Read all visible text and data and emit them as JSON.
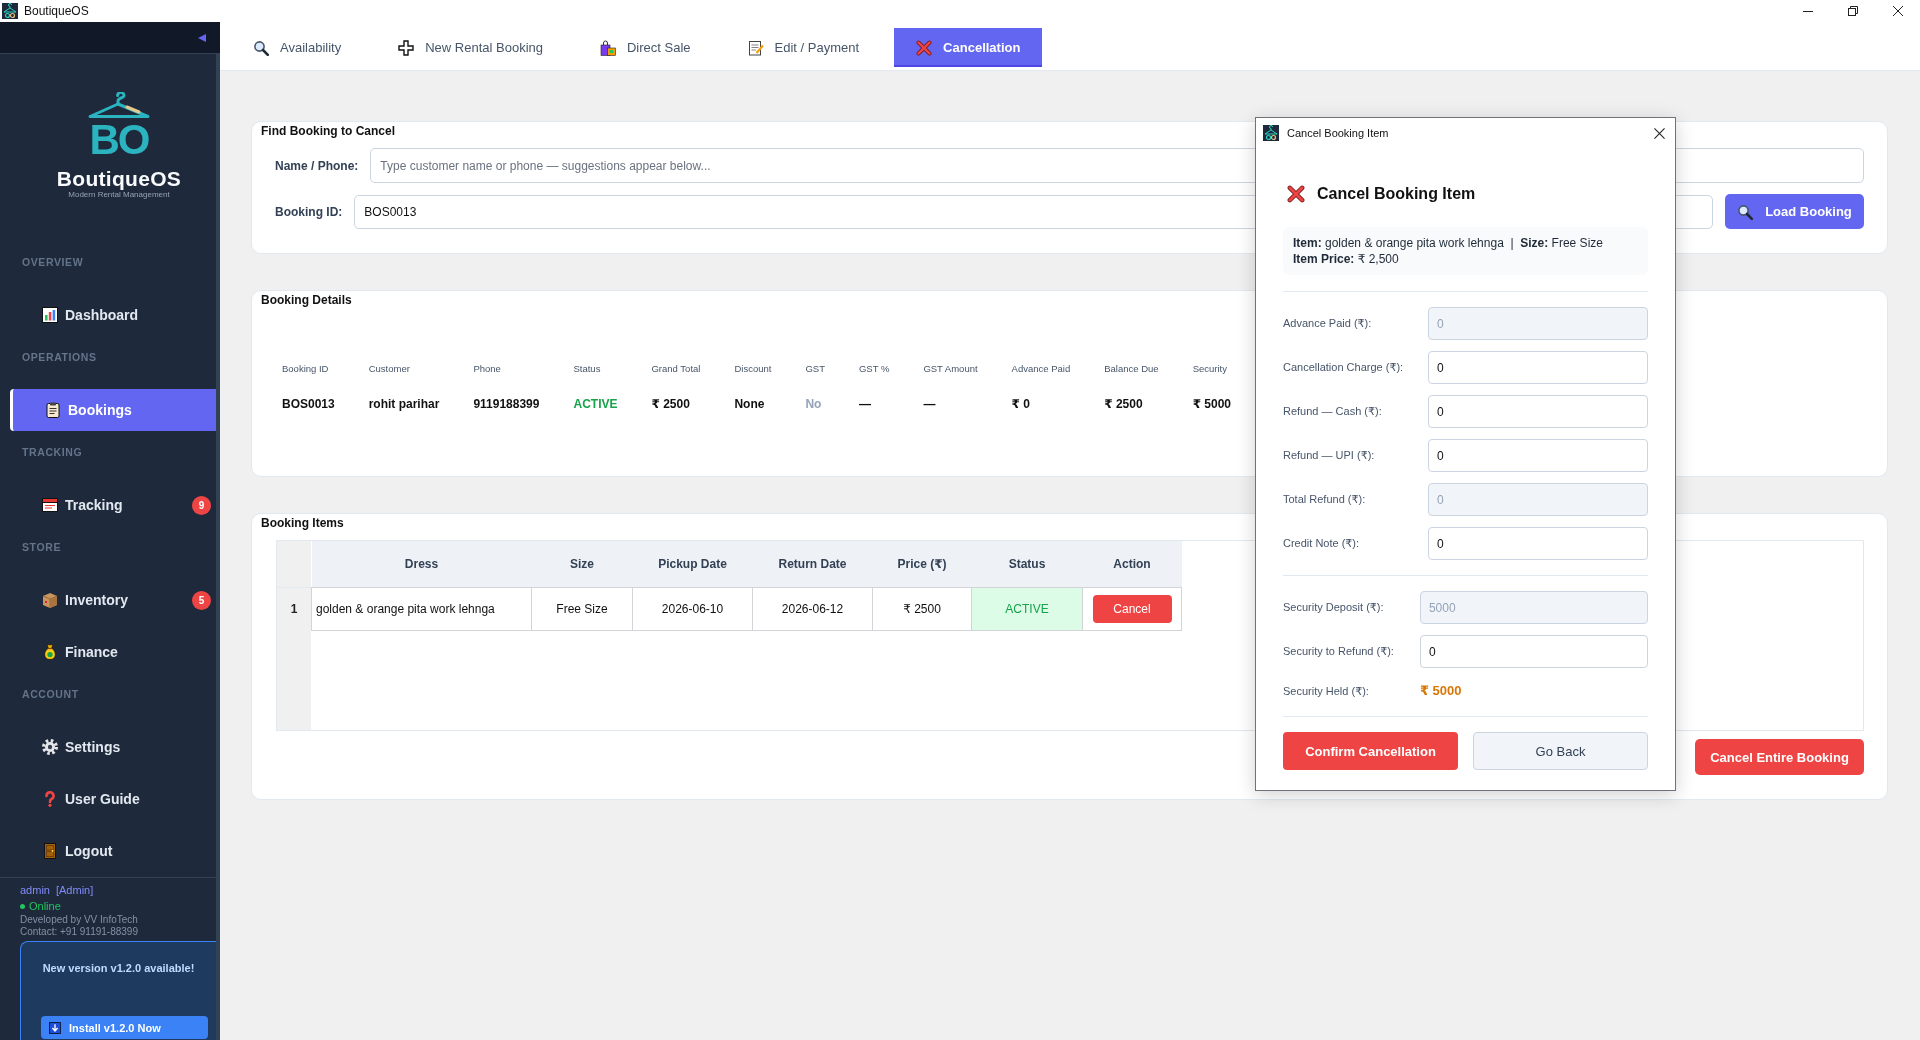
{
  "window": {
    "title": "BoutiqueOS"
  },
  "sidebar": {
    "brand": {
      "monogram": "BO",
      "name": "BoutiqueOS",
      "tagline": "Modern Rental Management"
    },
    "sections": [
      {
        "heading": "OVERVIEW",
        "items": [
          {
            "label": "Dashboard",
            "selected": false
          }
        ]
      },
      {
        "heading": "OPERATIONS",
        "items": [
          {
            "label": "Bookings",
            "selected": true
          }
        ]
      },
      {
        "heading": "TRACKING",
        "items": [
          {
            "label": "Tracking",
            "selected": false,
            "badge": "9"
          }
        ]
      },
      {
        "heading": "STORE",
        "items": [
          {
            "label": "Inventory",
            "selected": false,
            "badge": "5"
          },
          {
            "label": "Finance",
            "selected": false
          }
        ]
      },
      {
        "heading": "ACCOUNT",
        "items": [
          {
            "label": "Settings",
            "selected": false
          },
          {
            "label": "User Guide",
            "selected": false
          },
          {
            "label": "Logout",
            "selected": false
          }
        ]
      }
    ],
    "user": {
      "name": "admin",
      "role": "[Admin]",
      "status": "Online"
    },
    "credits": [
      "Developed by VV InfoTech",
      "Contact: +91 91191-88399"
    ],
    "update": {
      "message": "New version v1.2.0 available!",
      "button": "Install v1.2.0 Now"
    }
  },
  "tabs": [
    {
      "label": "Availability",
      "selected": false
    },
    {
      "label": "New Rental Booking",
      "selected": false
    },
    {
      "label": "Direct Sale",
      "selected": false
    },
    {
      "label": "Edit / Payment",
      "selected": false
    },
    {
      "label": "Cancellation",
      "selected": true
    }
  ],
  "find_booking": {
    "title": "Find Booking to Cancel",
    "name_phone": {
      "label": "Name / Phone:",
      "placeholder": "Type customer name or phone — suggestions appear below..."
    },
    "booking_id": {
      "label": "Booking ID:",
      "value": "BOS0013"
    },
    "load_button": "Load Booking"
  },
  "booking_details": {
    "title": "Booking Details",
    "columns": [
      "Booking ID",
      "Customer",
      "Phone",
      "Status",
      "Grand Total",
      "Discount",
      "GST",
      "GST %",
      "GST Amount",
      "Advance Paid",
      "Balance Due",
      "Security"
    ],
    "row": [
      {
        "value": "BOS0013",
        "kind": "text"
      },
      {
        "value": "rohit parihar",
        "kind": "text"
      },
      {
        "value": "9119188399",
        "kind": "text"
      },
      {
        "value": "ACTIVE",
        "kind": "status"
      },
      {
        "value": "₹ 2500",
        "kind": "text"
      },
      {
        "value": "None",
        "kind": "text"
      },
      {
        "value": "No",
        "kind": "muted"
      },
      {
        "value": "—",
        "kind": "text"
      },
      {
        "value": "—",
        "kind": "text"
      },
      {
        "value": "₹ 0",
        "kind": "text"
      },
      {
        "value": "₹ 2500",
        "kind": "text"
      },
      {
        "value": "₹ 5000",
        "kind": "text"
      }
    ]
  },
  "booking_items": {
    "title": "Booking Items",
    "columns": [
      "Dress",
      "Size",
      "Pickup Date",
      "Return Date",
      "Price (₹)",
      "Status",
      "Action"
    ],
    "rows": [
      {
        "number": "1",
        "cells": [
          "golden & orange pita work lehnga",
          "Free Size",
          "2026-06-10",
          "2026-06-12",
          "₹ 2500"
        ],
        "status": "ACTIVE",
        "action": "Cancel"
      }
    ],
    "cancel_all_button": "Cancel Entire Booking"
  },
  "dialog": {
    "title": "Cancel Booking Item",
    "heading": "Cancel Booking Item",
    "summary": [
      "**Item:** golden & orange pita work lehnga  |  **Size:** Free Size",
      "**Item Price:** ₹ 2,500"
    ],
    "refund_fields": [
      {
        "label": "Advance Paid (₹):",
        "value": "0",
        "disabled": true
      },
      {
        "label": "Cancellation Charge (₹):",
        "value": "0",
        "disabled": false
      },
      {
        "label": "Refund — Cash (₹):",
        "value": "0",
        "disabled": false
      },
      {
        "label": "Refund — UPI (₹):",
        "value": "0",
        "disabled": false
      },
      {
        "label": "Total Refund (₹):",
        "value": "0",
        "disabled": true
      },
      {
        "label": "Credit Note (₹):",
        "value": "0",
        "disabled": false
      }
    ],
    "security_fields": [
      {
        "label": "Security Deposit (₹):",
        "value": "5000",
        "disabled": true
      },
      {
        "label": "Security to Refund (₹):",
        "value": "0",
        "disabled": false
      }
    ],
    "security_held": {
      "label": "Security Held (₹):",
      "value": "₹ 5000"
    },
    "buttons": {
      "confirm": "Confirm Cancellation",
      "back": "Go Back"
    }
  }
}
